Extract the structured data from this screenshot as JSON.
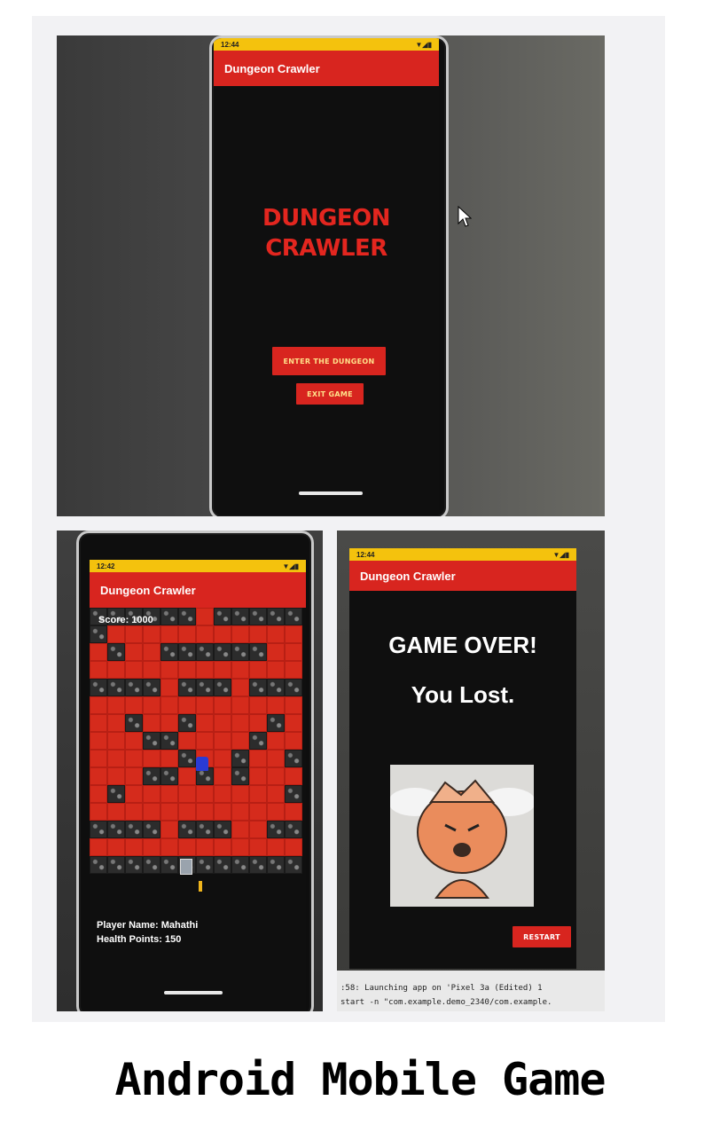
{
  "caption": "Android Mobile Game",
  "screens": {
    "menu": {
      "status_time": "12:44",
      "app_title": "Dungeon Crawler",
      "game_title_line1": "DUNGEON",
      "game_title_line2": "CRAWLER",
      "enter_button": "ENTER THE DUNGEON",
      "exit_button": "EXIT GAME"
    },
    "play": {
      "status_time": "12:42",
      "app_title": "Dungeon Crawler",
      "score": "Score: 1000",
      "player_name": "Player Name: Mahathi",
      "health": "Health Points: 150"
    },
    "game_over": {
      "status_time": "12:44",
      "app_title": "Dungeon Crawler",
      "line1": "GAME OVER!",
      "line2": "You Lost.",
      "restart_button": "RESTART"
    }
  },
  "terminal": {
    "line1": ":58: Launching app on 'Pixel 3a (Edited) 1",
    "line2": "start -n \"com.example.demo_2340/com.example."
  },
  "colors": {
    "accent_red": "#d8251f",
    "status_yellow": "#f4c20d",
    "button_text": "#ffe18a"
  },
  "icons": {
    "status": [
      "wifi-icon",
      "signal-icon",
      "battery-icon"
    ],
    "cursor": "mouse-pointer-icon",
    "character": "player-sprite-icon"
  }
}
